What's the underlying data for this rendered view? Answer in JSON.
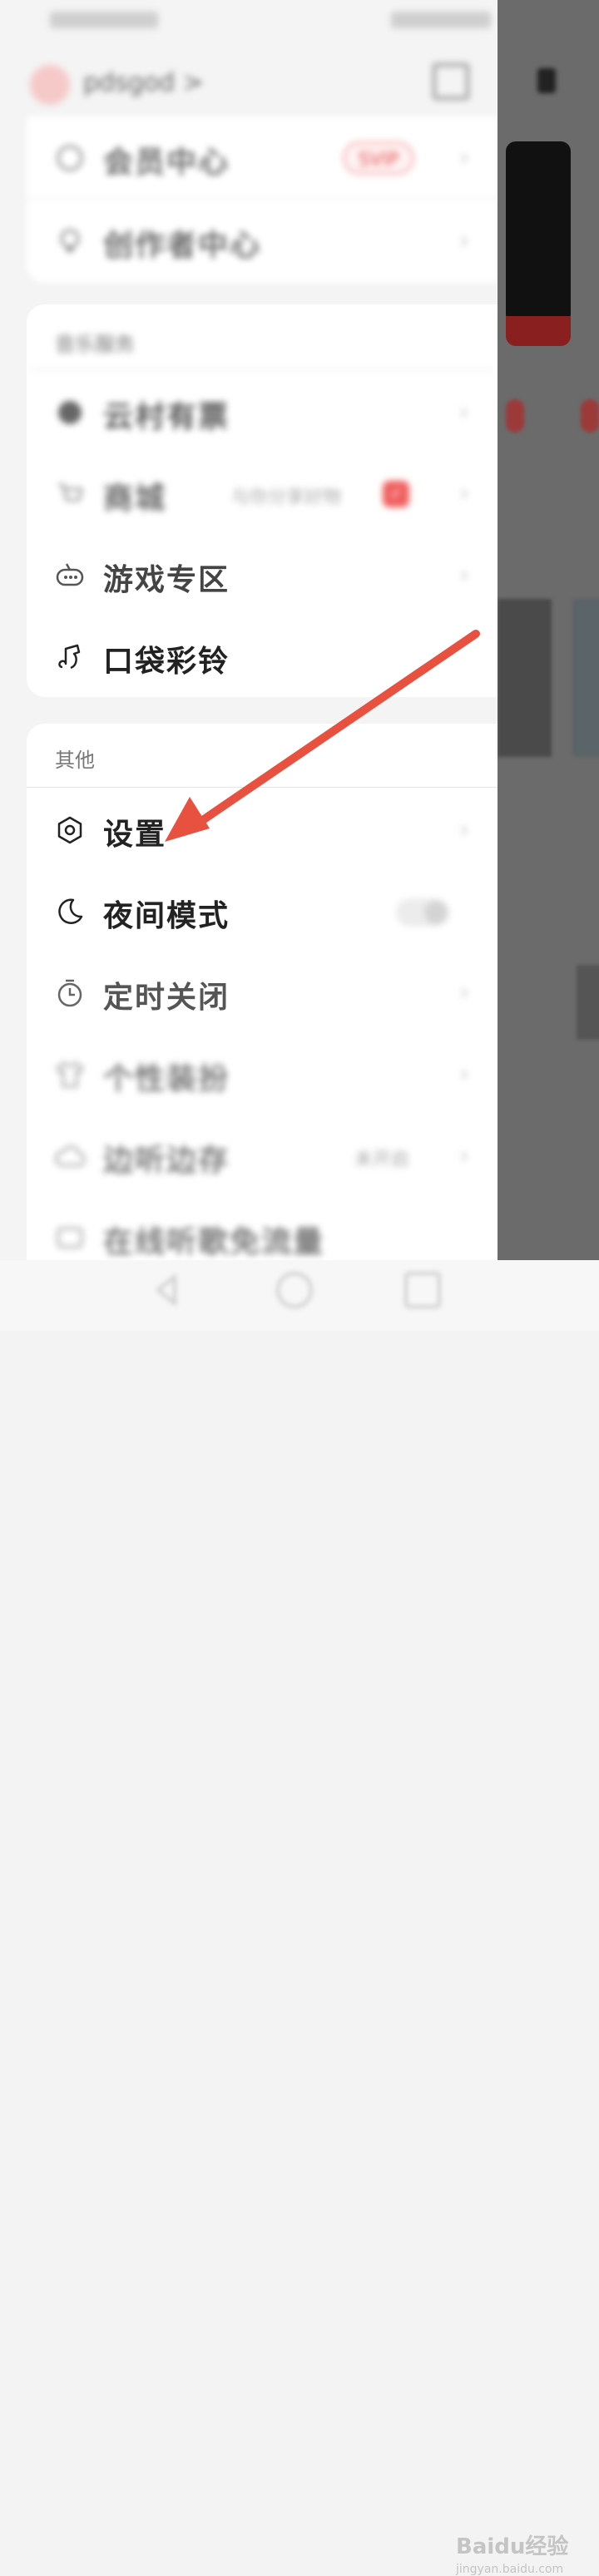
{
  "profile": {
    "username": "pdsgod >"
  },
  "account_card": {
    "rows": [
      {
        "label": "会员中心",
        "badge": "SVIP",
        "icon": "gem-icon"
      },
      {
        "label": "创作者中心",
        "icon": "bulb-icon"
      }
    ]
  },
  "music_card": {
    "title": "音乐服务",
    "rows": [
      {
        "label": "云村有票",
        "icon": "ticket-icon"
      },
      {
        "label": "商城",
        "extra": "与你分享好物",
        "icon": "cart-icon"
      },
      {
        "label": "游戏专区",
        "icon": "gamepad-icon"
      },
      {
        "label": "口袋彩铃",
        "icon": "music-bell-icon"
      }
    ]
  },
  "other_card": {
    "title": "其他",
    "rows": [
      {
        "label": "设置",
        "icon": "settings-hex-icon"
      },
      {
        "label": "夜间模式",
        "icon": "moon-icon"
      },
      {
        "label": "定时关闭",
        "icon": "timer-icon"
      },
      {
        "label": "个性装扮",
        "icon": "shirt-icon"
      },
      {
        "label": "边听边存",
        "extra": "未开启",
        "icon": "cloud-icon"
      },
      {
        "label": "在线听歌免流量",
        "icon": "data-icon"
      }
    ]
  },
  "watermark": {
    "brand": "Baidu经验",
    "domain": "jingyan.baidu.com"
  },
  "colors": {
    "arrow": "#e8513f",
    "accent": "#e04a4a",
    "dim_overlay": "#6b6b6b"
  }
}
